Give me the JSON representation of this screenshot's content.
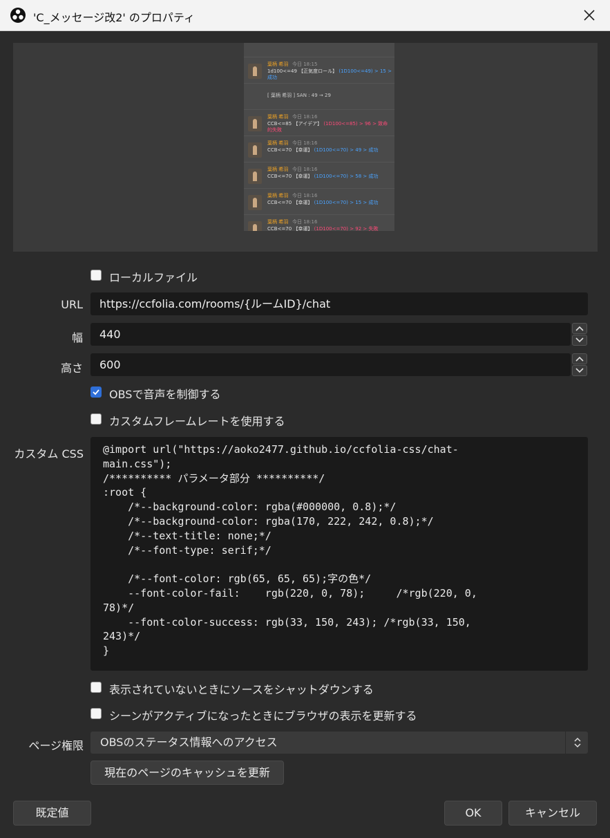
{
  "window": {
    "title": "'C_メッセージ改2' のプロパティ"
  },
  "preview": {
    "messages": [
      {
        "name": "",
        "time": "",
        "text": "",
        "result": "",
        "kind": "top"
      },
      {
        "name": "葉柄 希羽",
        "time": "今日 18:15",
        "text": "1d100<=49 【正気度ロール】",
        "result": "(1D100<=49) > 15 > 成功",
        "kind": "success"
      },
      {
        "name": "",
        "time": "",
        "text": "[ 葉柄 希羽 ] SAN : 49 → 29",
        "result": "",
        "kind": "sys"
      },
      {
        "name": "葉柄 希羽",
        "time": "今日 18:16",
        "text": "CCB<=85 【アイデア】",
        "result": "(1D100<=85) > 96 > 致命的失敗",
        "kind": "fail"
      },
      {
        "name": "葉柄 希羽",
        "time": "今日 18:16",
        "text": "CCB<=70 【幸運】",
        "result": "(1D100<=70) > 49 > 成功",
        "kind": "success"
      },
      {
        "name": "葉柄 希羽",
        "time": "今日 18:16",
        "text": "CCB<=70 【幸運】",
        "result": "(1D100<=70) > 58 > 成功",
        "kind": "success"
      },
      {
        "name": "葉柄 希羽",
        "time": "今日 18:16",
        "text": "CCB<=70 【幸運】",
        "result": "(1D100<=70) > 15 > 成功",
        "kind": "success"
      },
      {
        "name": "葉柄 希羽",
        "time": "今日 18:16",
        "text": "CCB<=70 【幸運】",
        "result": "(1D100<=70) > 92 > 失敗",
        "kind": "fail"
      }
    ]
  },
  "form": {
    "local_file_label": "ローカルファイル",
    "local_file_checked": false,
    "url_label": "URL",
    "url_value": "https://ccfolia.com/rooms/{ルームID}/chat",
    "width_label": "幅",
    "width_value": "440",
    "height_label": "高さ",
    "height_value": "600",
    "obs_audio_label": "OBSで音声を制御する",
    "obs_audio_checked": true,
    "custom_fps_label": "カスタムフレームレートを使用する",
    "custom_fps_checked": false,
    "custom_css_label": "カスタム CSS",
    "custom_css_value": "@import url(\"https://aoko2477.github.io/ccfolia-css/chat-\nmain.css\");\n/********** パラメータ部分 **********/\n:root {\n    /*--background-color: rgba(#000000, 0.8);*/\n    /*--background-color: rgba(170, 222, 242, 0.8);*/\n    /*--text-title: none;*/\n    /*--font-type: serif;*/\n\n    /*--font-color: rgb(65, 65, 65);字の色*/\n    --font-color-fail:    rgb(220, 0, 78);     /*rgb(220, 0,\n78)*/\n    --font-color-success: rgb(33, 150, 243); /*rgb(33, 150,\n243)*/\n}",
    "shutdown_label": "表示されていないときにソースをシャットダウンする",
    "shutdown_checked": false,
    "refresh_label": "シーンがアクティブになったときにブラウザの表示を更新する",
    "refresh_checked": false,
    "page_perm_label": "ページ権限",
    "page_perm_value": "OBSのステータス情報へのアクセス",
    "refresh_cache_button": "現在のページのキャッシュを更新"
  },
  "footer": {
    "defaults_button": "既定値",
    "ok_button": "OK",
    "cancel_button": "キャンセル"
  },
  "colors": {
    "accent": "#2f6fd8",
    "success": "#4aa3ff",
    "fail": "#ff4a78",
    "name": "#f5a623"
  }
}
